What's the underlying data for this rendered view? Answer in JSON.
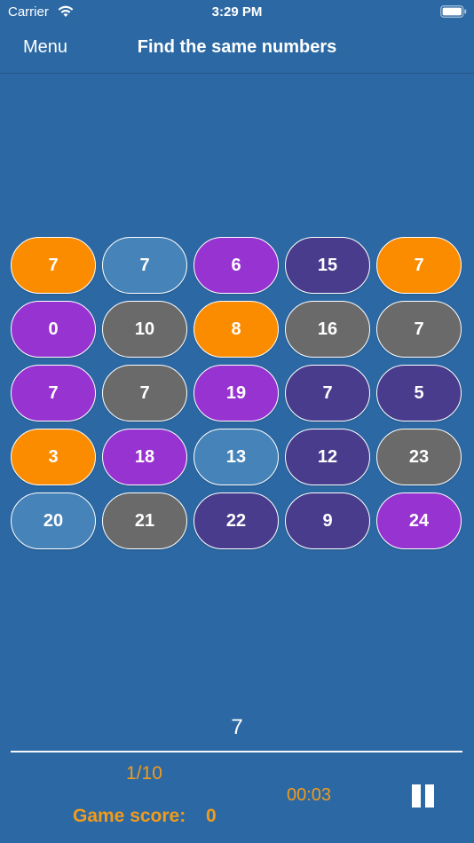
{
  "status_bar": {
    "carrier": "Carrier",
    "time": "3:29 PM",
    "wifi_icon": "wifi-icon",
    "battery_icon": "battery-icon"
  },
  "nav": {
    "menu_label": "Menu",
    "title": "Find the same numbers"
  },
  "colors": {
    "background": "#2c69a4",
    "orange": "#fb8c00",
    "light_blue": "#4683b8",
    "purple": "#9733d0",
    "dark_purple": "#4a3c8d",
    "gray": "#6a6a6a",
    "accent_text": "#f29b1a"
  },
  "grid": {
    "tiles": [
      {
        "label": "7",
        "color": "#fb8c00"
      },
      {
        "label": "7",
        "color": "#4683b8"
      },
      {
        "label": "6",
        "color": "#9733d0"
      },
      {
        "label": "15",
        "color": "#4a3c8d"
      },
      {
        "label": "7",
        "color": "#fb8c00"
      },
      {
        "label": "0",
        "color": "#9733d0"
      },
      {
        "label": "10",
        "color": "#6a6a6a"
      },
      {
        "label": "8",
        "color": "#fb8c00"
      },
      {
        "label": "16",
        "color": "#6a6a6a"
      },
      {
        "label": "7",
        "color": "#6a6a6a"
      },
      {
        "label": "7",
        "color": "#9733d0"
      },
      {
        "label": "7",
        "color": "#6a6a6a"
      },
      {
        "label": "19",
        "color": "#9733d0"
      },
      {
        "label": "7",
        "color": "#4a3c8d"
      },
      {
        "label": "5",
        "color": "#4a3c8d"
      },
      {
        "label": "3",
        "color": "#fb8c00"
      },
      {
        "label": "18",
        "color": "#9733d0"
      },
      {
        "label": "13",
        "color": "#4683b8"
      },
      {
        "label": "12",
        "color": "#4a3c8d"
      },
      {
        "label": "23",
        "color": "#6a6a6a"
      },
      {
        "label": "20",
        "color": "#4683b8"
      },
      {
        "label": "21",
        "color": "#6a6a6a"
      },
      {
        "label": "22",
        "color": "#4a3c8d"
      },
      {
        "label": "9",
        "color": "#4a3c8d"
      },
      {
        "label": "24",
        "color": "#9733d0"
      }
    ]
  },
  "game": {
    "target_number": "7",
    "progress": "1/10",
    "timer": "00:03",
    "score_label": "Game score:",
    "score_value": "0",
    "pause_icon": "pause-icon"
  }
}
